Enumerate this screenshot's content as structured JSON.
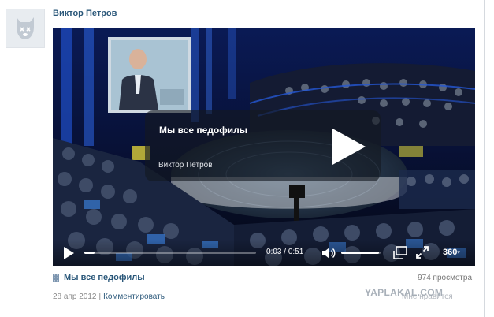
{
  "post": {
    "author": "Виктор Петров"
  },
  "video": {
    "overlay_title": "Мы все педофилы",
    "overlay_author": "Виктор Петров",
    "title": "Мы все педофилы",
    "current_time": "0:03",
    "duration": "0:51",
    "progress": 0.06,
    "volume": 0.95,
    "quality": "360",
    "views": "974 просмотра"
  },
  "meta": {
    "date": "28 апр 2012",
    "separator": "|",
    "comment_label": "Комментировать",
    "like_label": "Мне нравится"
  },
  "watermark": "YAPLAKAL.COM",
  "colors": {
    "link": "#2b587a",
    "meta": "#888888",
    "overlay_bg": "rgba(20,24,32,0.62)"
  }
}
